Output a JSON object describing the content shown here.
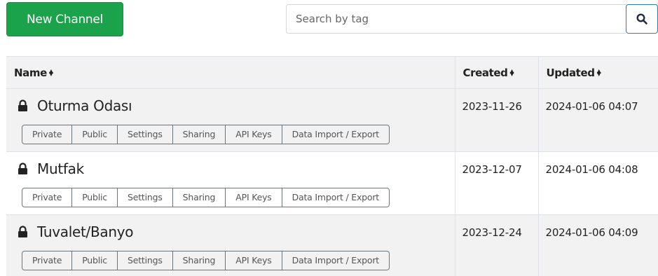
{
  "toolbar": {
    "new_channel_label": "New Channel"
  },
  "search": {
    "placeholder": "Search by tag"
  },
  "table": {
    "headers": {
      "name": "Name",
      "created": "Created",
      "updated": "Updated"
    },
    "action_labels": [
      "Private",
      "Public",
      "Settings",
      "Sharing",
      "API Keys",
      "Data Import / Export"
    ],
    "rows": [
      {
        "name": "Oturma Odası",
        "created": "2023-11-26",
        "updated": "2024-01-06 04:07"
      },
      {
        "name": "Mutfak",
        "created": "2023-12-07",
        "updated": "2024-01-06 04:08"
      },
      {
        "name": "Tuvalet/Banyo",
        "created": "2023-12-24",
        "updated": "2024-01-06 04:09"
      }
    ]
  },
  "icons": {
    "lock": "lock-icon",
    "search": "search-icon",
    "sort": "sort-icon"
  },
  "colors": {
    "primary_green": "#1aa34a",
    "search_border": "#2b7cb8"
  }
}
